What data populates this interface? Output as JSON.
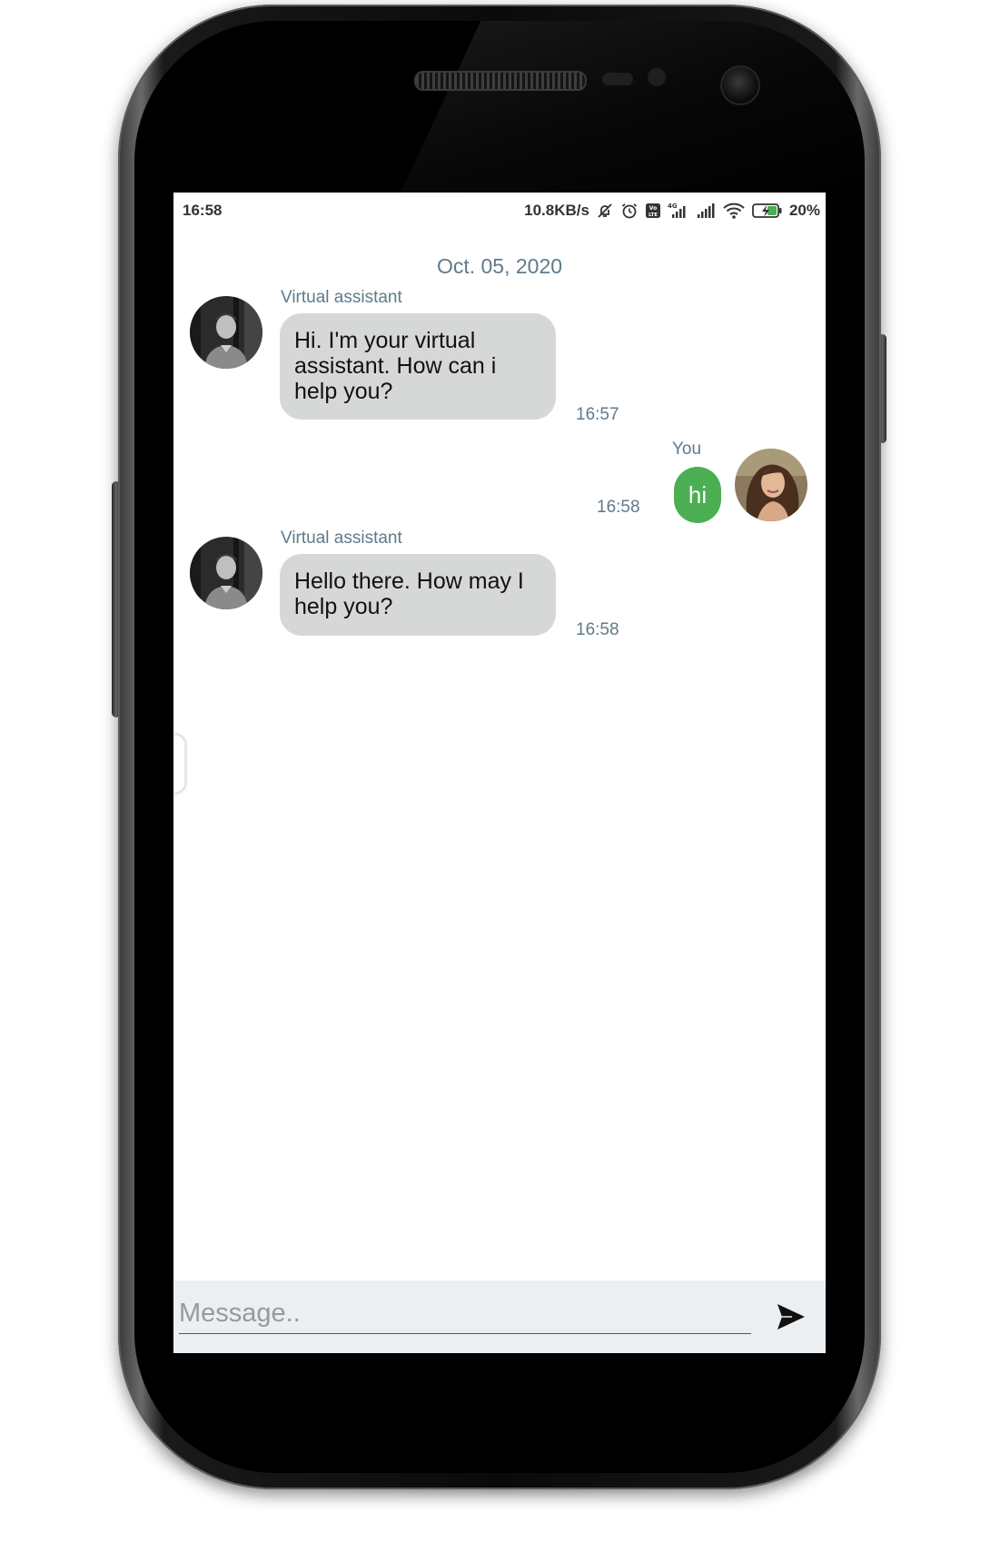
{
  "status_bar": {
    "time": "16:58",
    "network_speed": "10.8KB/s",
    "battery": "20%",
    "icons": [
      "mute-icon",
      "alarm-icon",
      "volte-icon",
      "4g-signal-icon",
      "signal-icon",
      "wifi-icon",
      "battery-charging-icon"
    ]
  },
  "chat": {
    "date": "Oct. 05, 2020",
    "messages": [
      {
        "sender": "Virtual assistant",
        "text": "Hi. I'm your virtual assistant. How can i help you?",
        "time": "16:57",
        "direction": "incoming"
      },
      {
        "sender": "You",
        "text": "hi",
        "time": "16:58",
        "direction": "outgoing"
      },
      {
        "sender": "Virtual assistant",
        "text": "Hello there. How may I help you?",
        "time": "16:58",
        "direction": "incoming"
      }
    ]
  },
  "composer": {
    "placeholder": "Message..",
    "value": ""
  },
  "colors": {
    "incoming_bubble": "#d6d7d7",
    "outgoing_bubble": "#4cae52",
    "meta_text": "#5f7a8a",
    "composer_bg": "#eceff2"
  }
}
